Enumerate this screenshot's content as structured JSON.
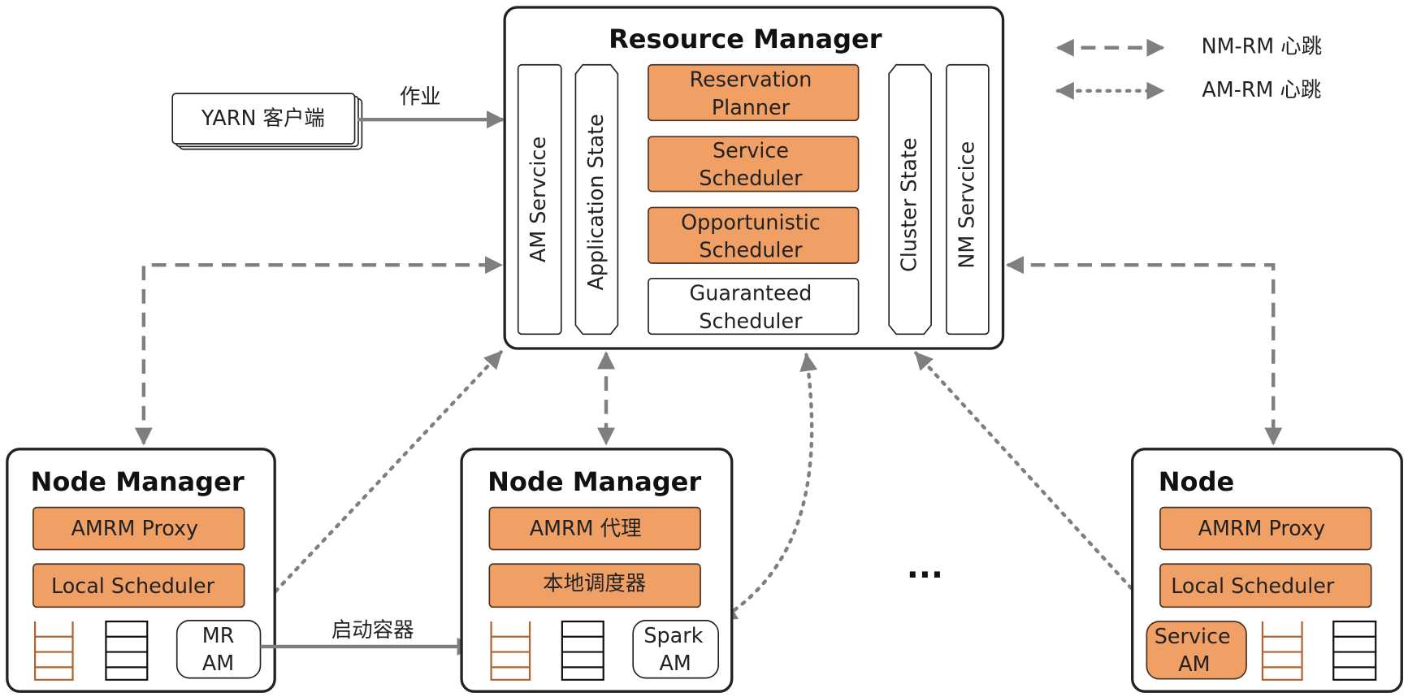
{
  "colors": {
    "component_fill": "#F0A064",
    "arrow": "#7f7f7f",
    "ladder": "#B0622F"
  },
  "legend": {
    "nm_rm": {
      "line": "dashed",
      "label": "NM-RM 心跳"
    },
    "am_rm": {
      "line": "dotted",
      "label": "AM-RM 心跳"
    }
  },
  "client": {
    "label": "YARN 客户端",
    "edge_label": "作业"
  },
  "resource_manager": {
    "title": "Resource Manager",
    "left_bars": [
      "AM Servcice",
      "Application State"
    ],
    "right_bars": [
      "Cluster State",
      "NM Servcice"
    ],
    "schedulers": [
      {
        "line1": "Reservation",
        "line2": "Planner",
        "highlight": true
      },
      {
        "line1": "Service",
        "line2": "Scheduler",
        "highlight": true
      },
      {
        "line1": "Opportunistic",
        "line2": "Scheduler",
        "highlight": true
      },
      {
        "line1": "Guaranteed",
        "line2": "Scheduler",
        "highlight": false
      }
    ]
  },
  "nodes": [
    {
      "title": "Node Manager",
      "proxy": "AMRM Proxy",
      "scheduler": "Local Scheduler",
      "am_line1": "MR",
      "am_line2": "AM"
    },
    {
      "title": "Node Manager",
      "proxy": "AMRM 代理",
      "scheduler": "本地调度器",
      "am_line1": "Spark",
      "am_line2": "AM"
    },
    {
      "title": "Node",
      "proxy": "AMRM Proxy",
      "scheduler": "Local Scheduler",
      "am_line1": "Service",
      "am_line2": "AM"
    }
  ],
  "launch_label": "启动容器",
  "ellipsis": "..."
}
